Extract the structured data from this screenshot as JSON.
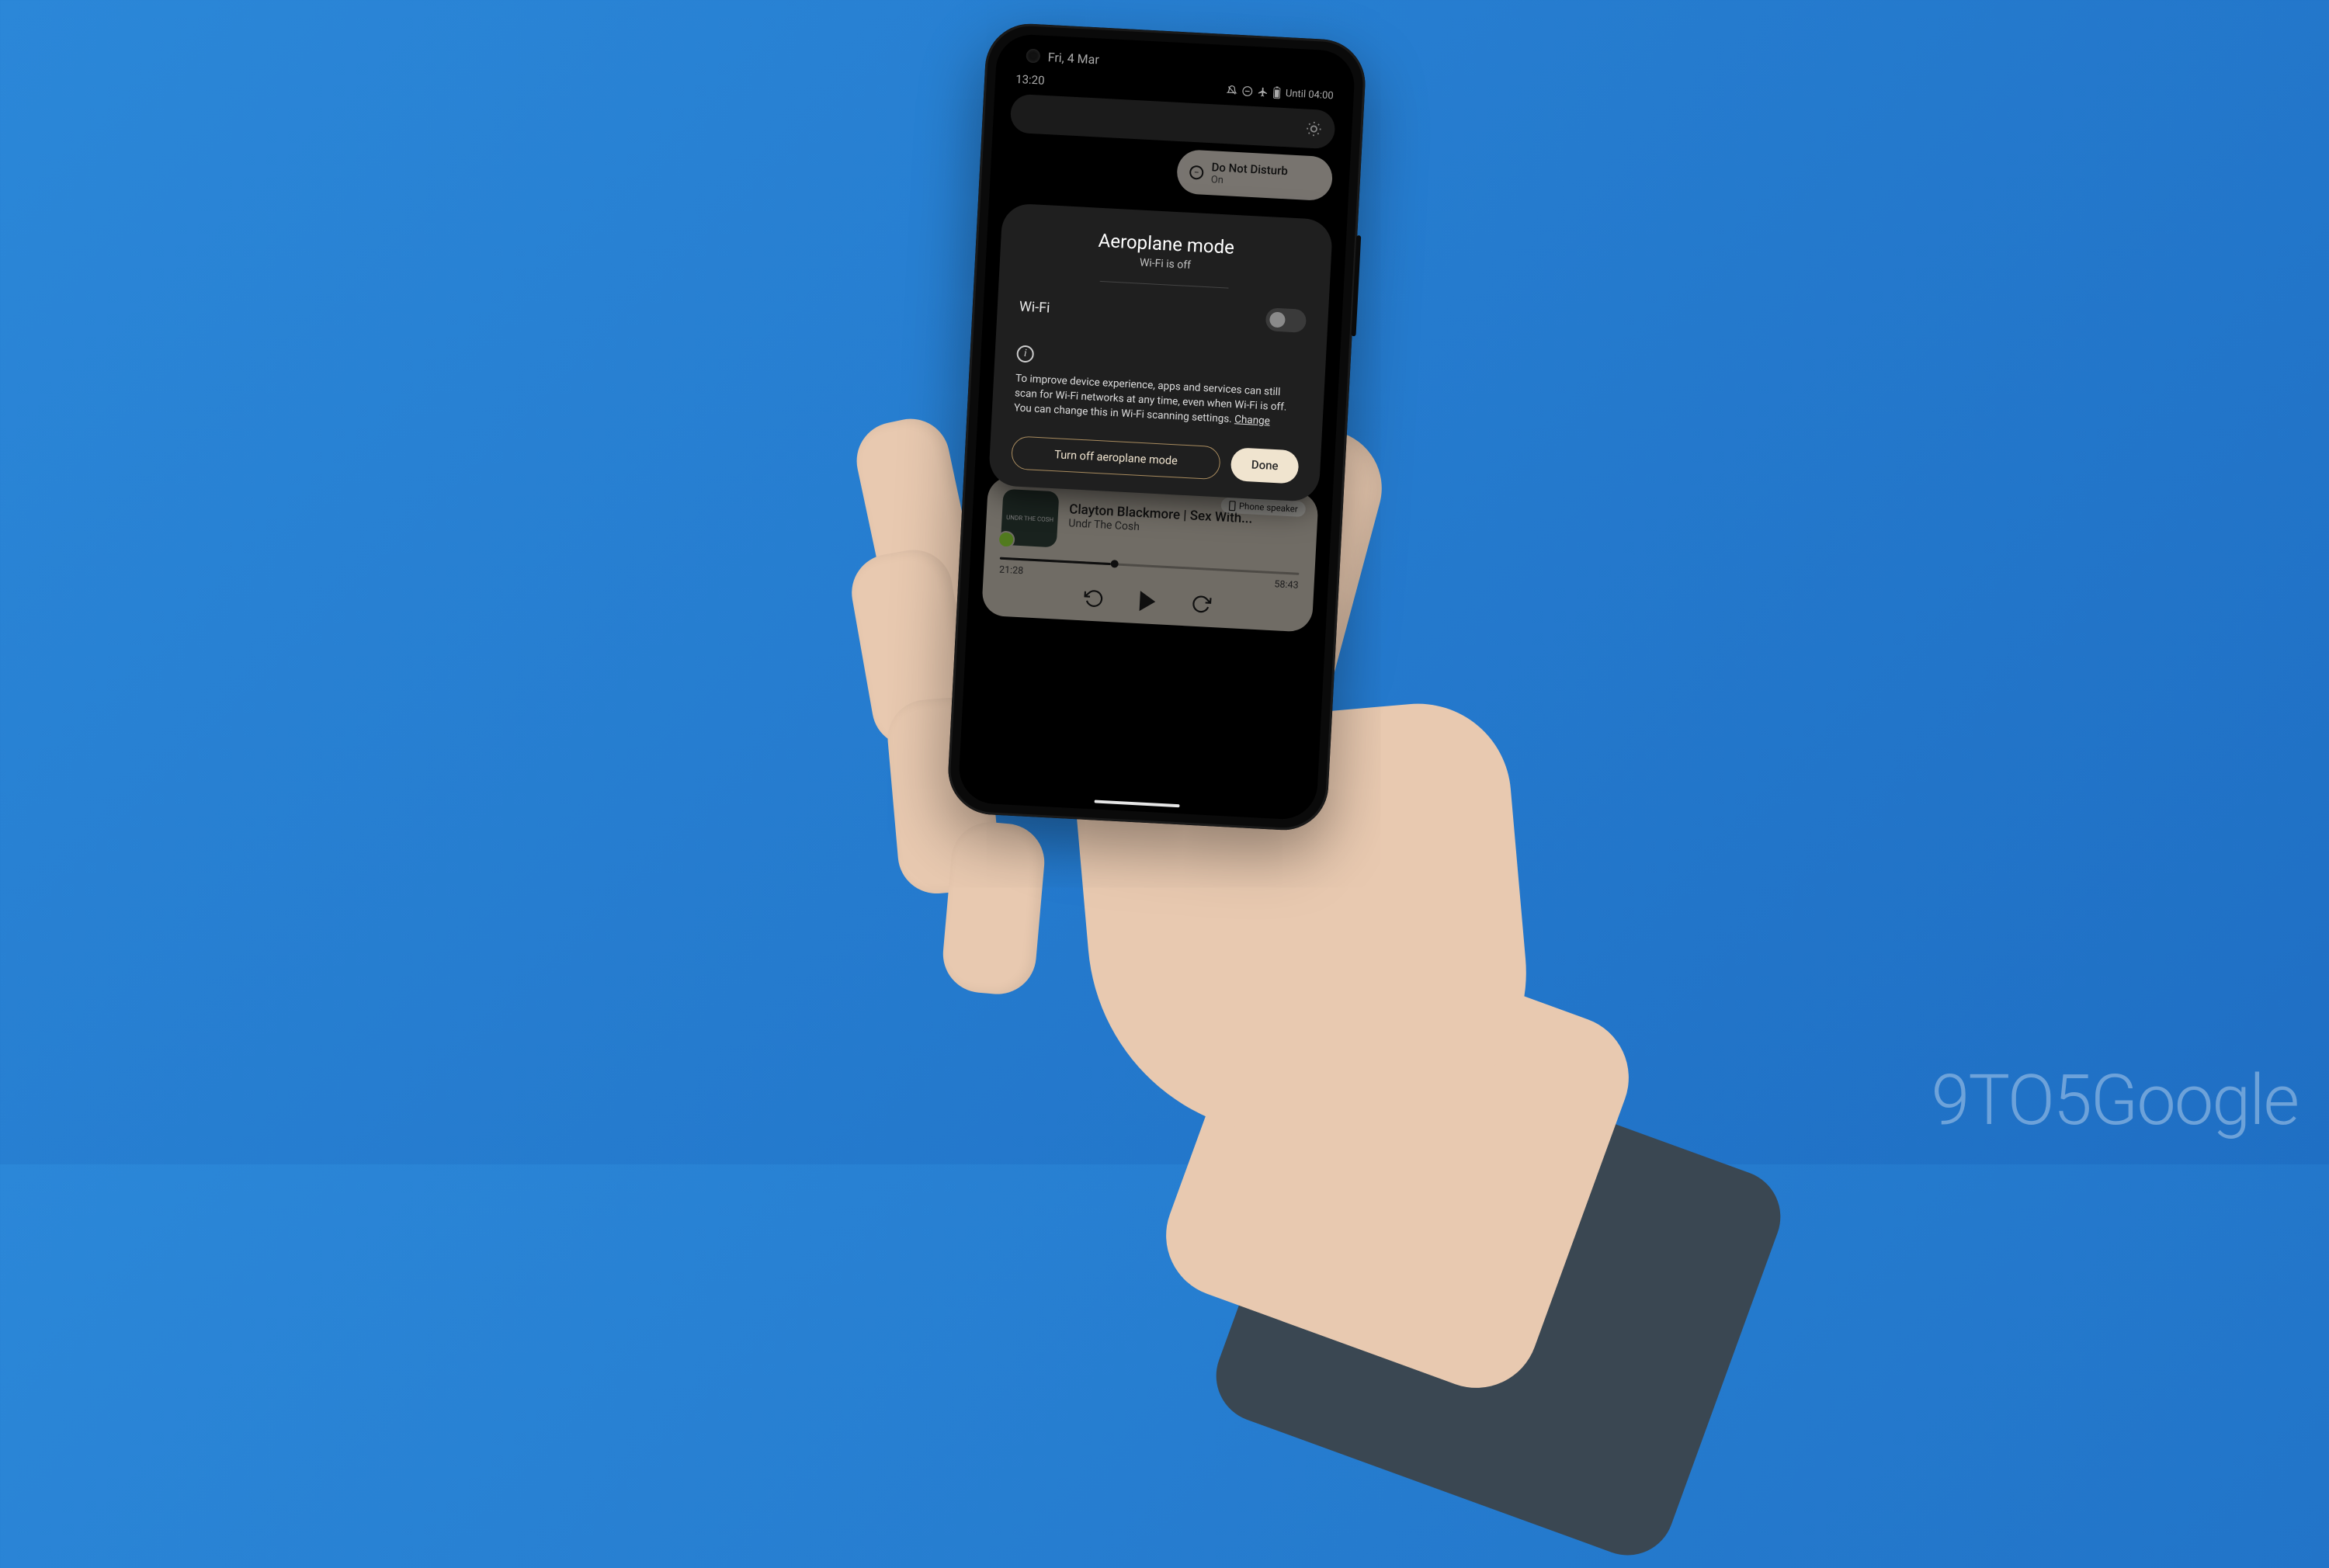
{
  "watermark": "9TO5Google",
  "statusbar": {
    "date": "Fri, 4 Mar",
    "time": "13:20",
    "until_label": "Until 04:00"
  },
  "qs": {
    "dnd": {
      "title": "Do Not Disturb",
      "subtitle": "On"
    }
  },
  "modal": {
    "title": "Aeroplane mode",
    "subtitle": "Wi-Fi is off",
    "wifi_label": "Wi-Fi",
    "info_text": "To improve device experience, apps and services can still scan for Wi-Fi networks at any time, even when Wi-Fi is off. You can change this in Wi-Fi scanning settings.",
    "change_link": "Change",
    "turn_off_label": "Turn off aeroplane mode",
    "done_label": "Done"
  },
  "media": {
    "output_chip": "Phone speaker",
    "title": "Clayton Blackmore | Sex With...",
    "artist": "Undr The Cosh",
    "album_text": "UNDR THE COSH",
    "elapsed": "21:28",
    "duration": "58:43"
  }
}
